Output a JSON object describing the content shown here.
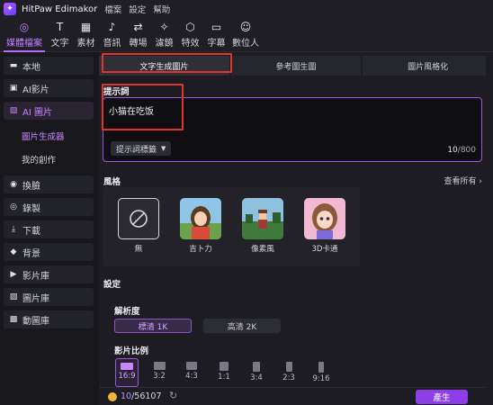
{
  "titlebar": {
    "app_name": "HitPaw Edimakor",
    "menu": [
      "檔案",
      "設定",
      "幫助"
    ]
  },
  "toolbar": {
    "tools": [
      {
        "label": "媒體檔案",
        "icon": "media-icon"
      },
      {
        "label": "文字",
        "icon": "text-icon"
      },
      {
        "label": "素材",
        "icon": "materials-icon"
      },
      {
        "label": "音訊",
        "icon": "audio-icon"
      },
      {
        "label": "轉場",
        "icon": "transition-icon"
      },
      {
        "label": "濾鏡",
        "icon": "filter-icon"
      },
      {
        "label": "特效",
        "icon": "effects-icon"
      },
      {
        "label": "字幕",
        "icon": "subtitle-icon"
      },
      {
        "label": "數位人",
        "icon": "digital-human-icon"
      }
    ]
  },
  "sidebar": {
    "items": [
      {
        "label": "本地",
        "icon": "folder-icon"
      },
      {
        "label": "AI影片",
        "icon": "ai-video-icon"
      },
      {
        "label": "AI 圖片",
        "icon": "ai-image-icon"
      },
      {
        "label": "圖片生成器"
      },
      {
        "label": "我的創作"
      },
      {
        "label": "換臉",
        "icon": "face-swap-icon"
      },
      {
        "label": "錄製",
        "icon": "record-icon"
      },
      {
        "label": "下載",
        "icon": "download-icon"
      },
      {
        "label": "背景",
        "icon": "background-icon"
      },
      {
        "label": "影片庫",
        "icon": "video-library-icon"
      },
      {
        "label": "圖片庫",
        "icon": "image-library-icon"
      },
      {
        "label": "動圖庫",
        "icon": "gif-library-icon"
      }
    ]
  },
  "tabs": [
    "文字生成圖片",
    "參考圖生圖",
    "圖片風格化"
  ],
  "prompt": {
    "label": "提示詞",
    "value": "小猫在吃饭",
    "tag_button": "提示詞標籤",
    "count": "10",
    "max": "/800"
  },
  "styles": {
    "label": "風格",
    "see_all": "查看所有 ›",
    "items": [
      "無",
      "吉卜力",
      "像素風",
      "3D卡通"
    ]
  },
  "settings": {
    "label": "設定",
    "resolution_label": "解析度",
    "resolutions": [
      "標清 1K",
      "高清 2K"
    ],
    "ratio_label": "影片比例",
    "ratios": [
      "16:9",
      "3:2",
      "4:3",
      "1:1",
      "3:4",
      "2:3",
      "9:16"
    ]
  },
  "bottombar": {
    "credits_used": "10",
    "credits_total": "/56107",
    "generate": "產生"
  },
  "colors": {
    "accent": "#b469ff",
    "highlight_box": "#e0342c",
    "generate_button": "#8e3ee6"
  }
}
